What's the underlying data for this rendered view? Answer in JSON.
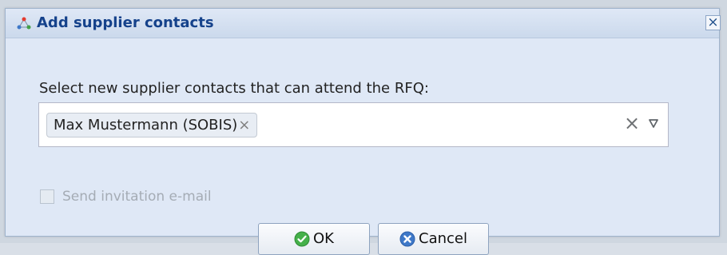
{
  "dialog": {
    "title": "Add supplier contacts",
    "prompt": "Select new supplier contacts that can attend the RFQ:",
    "selected_contacts": [
      "Max Mustermann (SOBIS)"
    ],
    "checkbox_label": "Send invitation e-mail",
    "checkbox_checked": false,
    "checkbox_enabled": false,
    "buttons": {
      "ok": "OK",
      "cancel": "Cancel"
    },
    "icons": {
      "title": "triangle-network-icon",
      "close": "close-icon",
      "token_remove": "close-icon",
      "clear": "clear-icon",
      "dropdown": "chevron-down-icon",
      "ok": "check-circle-icon",
      "cancel": "cancel-circle-icon"
    },
    "colors": {
      "title_text": "#15428b",
      "window_bg": "#dfe8f6",
      "ok_icon": "#45b04a",
      "cancel_icon": "#3e78c8"
    }
  }
}
